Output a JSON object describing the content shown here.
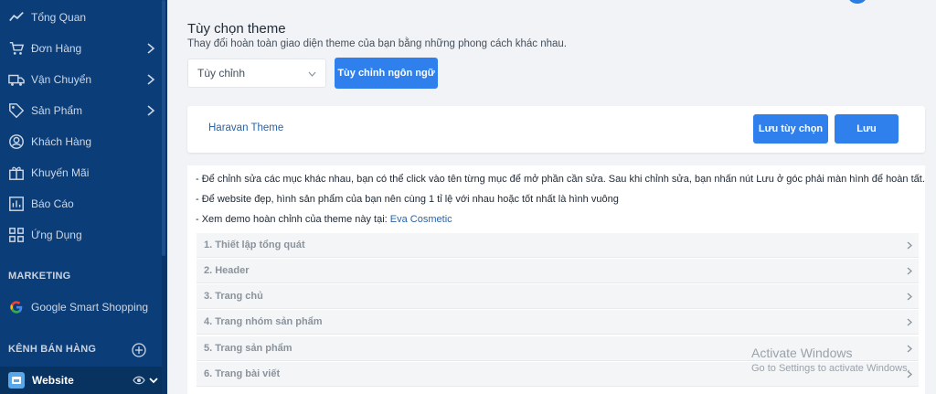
{
  "sidebar": {
    "items": [
      {
        "label": "Tổng Quan",
        "icon": "trend-icon",
        "chevron": false
      },
      {
        "label": "Đơn Hàng",
        "icon": "cart-icon",
        "chevron": true
      },
      {
        "label": "Vận Chuyển",
        "icon": "truck-icon",
        "chevron": true
      },
      {
        "label": "Sản Phẩm",
        "icon": "tag-icon",
        "chevron": true
      },
      {
        "label": "Khách Hàng",
        "icon": "user-icon",
        "chevron": false
      },
      {
        "label": "Khuyến Mãi",
        "icon": "gift-icon",
        "chevron": false
      },
      {
        "label": "Báo Cáo",
        "icon": "report-icon",
        "chevron": false
      },
      {
        "label": "Ứng Dụng",
        "icon": "apps-icon",
        "chevron": false
      }
    ],
    "marketing_title": "MARKETING",
    "google_label": "Google Smart Shopping",
    "channels_title": "KÊNH BÁN HÀNG",
    "website_label": "Website"
  },
  "main": {
    "title": "Tùy chọn theme",
    "subtitle": "Thay đổi hoàn toàn giao diện theme của bạn bằng những phong cách khác nhau.",
    "select_value": "Tùy chỉnh",
    "customize_language_button": "Tùy chỉnh ngôn ngữ",
    "theme_name": "Haravan Theme",
    "save_options_button": "Lưu tùy chọn",
    "save_button": "Lưu",
    "notes": [
      "- Để chỉnh sửa các mục khác nhau, bạn có thể click vào tên từng mục để mở phần cần sửa. Sau khi chỉnh sửa, bạn nhấn nút Lưu ở góc phải màn hình để hoàn tất.",
      "- Để website đẹp, hình sản phẩm của bạn nên cùng 1 tỉ lệ với nhau hoặc tốt nhất là hình vuông"
    ],
    "demo_prefix": "- Xem demo hoàn chỉnh của theme này tại: ",
    "demo_link": "Eva Cosmetic",
    "sections": [
      "1. Thiết lập tổng quát",
      "2. Header",
      "3. Trang chủ",
      "4. Trang nhóm sản phẩm",
      "5. Trang sản phẩm",
      "6. Trang bài viết"
    ]
  },
  "watermark": {
    "line1": "Activate Windows",
    "line2": "Go to Settings to activate Windows."
  },
  "colors": {
    "sidebar": "#0b3d78",
    "primary": "#2f80ed",
    "link": "#2a63a6"
  }
}
